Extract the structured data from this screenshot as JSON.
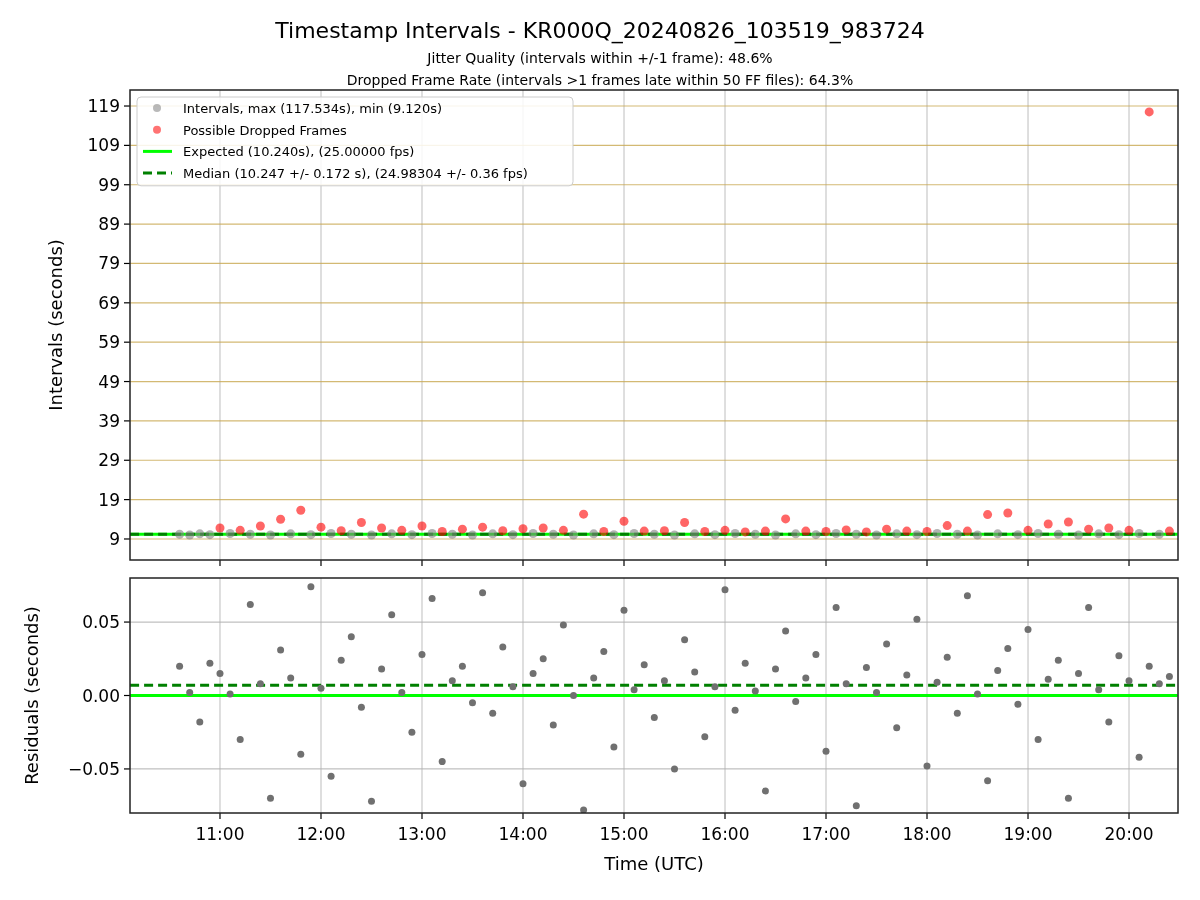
{
  "title": "Timestamp Intervals - KR000Q_20240826_103519_983724",
  "subtitles": [
    "Jitter Quality (intervals within +/-1 frame): 48.6%",
    "Dropped Frame Rate (intervals >1 frames late within 50 FF files): 64.3%"
  ],
  "intervals_panel": {
    "chart_data": {
      "type": "scatter",
      "ylabel": "Intervals (seconds)",
      "grid": true,
      "legend": "upper left",
      "x": [
        10.11,
        10.6,
        10.7,
        10.8,
        10.9,
        11.0,
        11.1,
        11.2,
        11.3,
        11.4,
        11.5,
        11.6,
        11.7,
        11.8,
        11.9,
        12.0,
        12.1,
        12.2,
        12.3,
        12.4,
        12.5,
        12.6,
        12.7,
        12.8,
        12.9,
        13.0,
        13.1,
        13.2,
        13.3,
        13.4,
        13.5,
        13.6,
        13.7,
        13.8,
        13.9,
        14.0,
        14.1,
        14.2,
        14.3,
        14.4,
        14.5,
        14.6,
        14.7,
        14.8,
        14.9,
        15.0,
        15.1,
        15.2,
        15.3,
        15.4,
        15.5,
        15.6,
        15.7,
        15.8,
        15.9,
        16.0,
        16.1,
        16.2,
        16.3,
        16.4,
        16.5,
        16.6,
        16.7,
        16.8,
        16.9,
        17.0,
        17.1,
        17.2,
        17.3,
        17.4,
        17.5,
        17.6,
        17.7,
        17.8,
        17.9,
        18.0,
        18.1,
        18.2,
        18.3,
        18.4,
        18.5,
        18.6,
        18.7,
        18.8,
        18.9,
        19.0,
        19.1,
        19.2,
        19.3,
        19.4,
        19.5,
        19.6,
        19.7,
        19.8,
        19.9,
        20.0,
        20.1,
        20.2,
        20.3,
        20.4,
        20.48
      ],
      "series": [
        {
          "name": "Intervals, max (117.534s), min (9.120s)",
          "color": "#808080",
          "values": [
            null,
            10.2,
            10.0,
            10.3,
            10.1,
            null,
            10.4,
            null,
            10.2,
            null,
            10.0,
            null,
            10.3,
            null,
            10.1,
            null,
            10.4,
            null,
            10.2,
            null,
            10.0,
            null,
            10.3,
            null,
            10.1,
            null,
            10.4,
            null,
            10.2,
            null,
            10.0,
            null,
            10.3,
            null,
            10.1,
            null,
            10.4,
            null,
            10.2,
            null,
            10.0,
            null,
            10.3,
            null,
            10.1,
            null,
            10.4,
            null,
            10.2,
            null,
            10.0,
            null,
            10.3,
            null,
            10.1,
            null,
            10.4,
            null,
            10.2,
            null,
            10.0,
            null,
            10.3,
            null,
            10.1,
            null,
            10.4,
            null,
            10.2,
            null,
            10.0,
            null,
            10.3,
            null,
            10.1,
            null,
            10.4,
            null,
            10.2,
            null,
            10.0,
            null,
            10.3,
            null,
            10.1,
            null,
            10.4,
            null,
            10.2,
            null,
            10.0,
            null,
            10.3,
            null,
            10.1,
            null,
            10.4,
            null,
            10.2,
            null,
            null
          ]
        },
        {
          "name": "Possible Dropped Frames",
          "color": "#ff0000",
          "values": [
            null,
            null,
            null,
            null,
            null,
            11.8,
            null,
            11.2,
            null,
            12.3,
            null,
            14.0,
            null,
            16.3,
            null,
            12.0,
            null,
            11.1,
            null,
            13.2,
            null,
            11.8,
            null,
            11.2,
            null,
            12.3,
            null,
            10.9,
            null,
            11.5,
            null,
            12.0,
            null,
            11.1,
            null,
            11.6,
            null,
            11.8,
            null,
            11.2,
            null,
            15.3,
            null,
            10.9,
            null,
            13.5,
            null,
            11.0,
            null,
            11.1,
            null,
            13.2,
            null,
            10.9,
            null,
            11.2,
            null,
            10.8,
            null,
            11.0,
            null,
            14.1,
            null,
            11.0,
            null,
            10.9,
            null,
            11.3,
            null,
            10.8,
            null,
            11.5,
            null,
            11.0,
            null,
            10.9,
            null,
            12.4,
            null,
            11.0,
            null,
            15.2,
            null,
            15.6,
            null,
            11.2,
            null,
            12.8,
            null,
            13.3,
            null,
            11.5,
            null,
            11.8,
            null,
            11.2,
            null,
            117.5,
            null,
            11.0,
            null
          ]
        },
        {
          "name": "Expected (10.240s), (25.00000 fps)",
          "color": "#00ff00",
          "type": "line",
          "line_style": "solid",
          "values": [
            10.2,
            10.2,
            10.2,
            10.2,
            10.2,
            10.2,
            10.2,
            10.2,
            10.2,
            10.2,
            10.2,
            10.2,
            10.2,
            10.2,
            10.2,
            10.2,
            10.2,
            10.2,
            10.2,
            10.2,
            10.2,
            10.2,
            10.2,
            10.2,
            10.2,
            10.2,
            10.2,
            10.2,
            10.2,
            10.2,
            10.2,
            10.2,
            10.2,
            10.2,
            10.2,
            10.2,
            10.2,
            10.2,
            10.2,
            10.2,
            10.2,
            10.2,
            10.2,
            10.2,
            10.2,
            10.2,
            10.2,
            10.2,
            10.2,
            10.2,
            10.2,
            10.2,
            10.2,
            10.2,
            10.2,
            10.2,
            10.2,
            10.2,
            10.2,
            10.2,
            10.2,
            10.2,
            10.2,
            10.2,
            10.2,
            10.2,
            10.2,
            10.2,
            10.2,
            10.2,
            10.2,
            10.2,
            10.2,
            10.2,
            10.2,
            10.2,
            10.2,
            10.2,
            10.2,
            10.2,
            10.2,
            10.2,
            10.2,
            10.2,
            10.2,
            10.2,
            10.2,
            10.2,
            10.2,
            10.2,
            10.2,
            10.2,
            10.2,
            10.2,
            10.2,
            10.2,
            10.2,
            10.2,
            10.2,
            10.2,
            10.2
          ]
        },
        {
          "name": "Median (10.247 +/- 0.172 s), (24.98304 +/- 0.36 fps)",
          "color": "#008000",
          "type": "line",
          "line_style": "dashed",
          "values": [
            10.2,
            10.2,
            10.2,
            10.2,
            10.2,
            10.2,
            10.2,
            10.2,
            10.2,
            10.2,
            10.2,
            10.2,
            10.2,
            10.2,
            10.2,
            10.2,
            10.2,
            10.2,
            10.2,
            10.2,
            10.2,
            10.2,
            10.2,
            10.2,
            10.2,
            10.2,
            10.2,
            10.2,
            10.2,
            10.2,
            10.2,
            10.2,
            10.2,
            10.2,
            10.2,
            10.2,
            10.2,
            10.2,
            10.2,
            10.2,
            10.2,
            10.2,
            10.2,
            10.2,
            10.2,
            10.2,
            10.2,
            10.2,
            10.2,
            10.2,
            10.2,
            10.2,
            10.2,
            10.2,
            10.2,
            10.2,
            10.2,
            10.2,
            10.2,
            10.2,
            10.2,
            10.2,
            10.2,
            10.2,
            10.2,
            10.2,
            10.2,
            10.2,
            10.2,
            10.2,
            10.2,
            10.2,
            10.2,
            10.2,
            10.2,
            10.2,
            10.2,
            10.2,
            10.2,
            10.2,
            10.2,
            10.2,
            10.2,
            10.2,
            10.2,
            10.2,
            10.2,
            10.2,
            10.2,
            10.2,
            10.2,
            10.2,
            10.2,
            10.2,
            10.2,
            10.2,
            10.2,
            10.2,
            10.2,
            10.2,
            10.2
          ]
        }
      ],
      "xlim": [
        10.109,
        20.485
      ],
      "ylim": [
        3.66,
        123.07
      ],
      "yticks": [
        9,
        19,
        29,
        39,
        49,
        59,
        69,
        79,
        89,
        99,
        109,
        119
      ]
    }
  },
  "residuals_panel": {
    "chart_data": {
      "type": "scatter",
      "xlabel": "Time (UTC)",
      "ylabel": "Residuals (seconds)",
      "grid": true,
      "x": [
        10.11,
        10.6,
        10.7,
        10.8,
        10.9,
        11.0,
        11.1,
        11.2,
        11.3,
        11.4,
        11.5,
        11.6,
        11.7,
        11.8,
        11.9,
        12.0,
        12.1,
        12.2,
        12.3,
        12.4,
        12.5,
        12.6,
        12.7,
        12.8,
        12.9,
        13.0,
        13.1,
        13.2,
        13.3,
        13.4,
        13.5,
        13.6,
        13.7,
        13.8,
        13.9,
        14.0,
        14.1,
        14.2,
        14.3,
        14.4,
        14.5,
        14.6,
        14.7,
        14.8,
        14.9,
        15.0,
        15.1,
        15.2,
        15.3,
        15.4,
        15.5,
        15.6,
        15.7,
        15.8,
        15.9,
        16.0,
        16.1,
        16.2,
        16.3,
        16.4,
        16.5,
        16.6,
        16.7,
        16.8,
        16.9,
        17.0,
        17.1,
        17.2,
        17.3,
        17.4,
        17.5,
        17.6,
        17.7,
        17.8,
        17.9,
        18.0,
        18.1,
        18.2,
        18.3,
        18.4,
        18.5,
        18.6,
        18.7,
        18.8,
        18.9,
        19.0,
        19.1,
        19.2,
        19.3,
        19.4,
        19.5,
        19.6,
        19.7,
        19.8,
        19.9,
        20.0,
        20.1,
        20.2,
        20.3,
        20.4,
        20.48
      ],
      "series": [
        {
          "color": "#707070",
          "values": [
            null,
            0.02,
            0.002,
            -0.018,
            0.022,
            0.015,
            0.001,
            -0.03,
            0.062,
            0.008,
            -0.07,
            0.031,
            0.012,
            -0.04,
            0.074,
            0.005,
            -0.055,
            0.024,
            0.04,
            -0.008,
            -0.072,
            0.018,
            0.055,
            0.002,
            -0.025,
            0.028,
            0.066,
            -0.045,
            0.01,
            0.02,
            -0.005,
            0.07,
            -0.012,
            0.033,
            0.006,
            -0.06,
            0.015,
            0.025,
            -0.02,
            0.048,
            0.0,
            -0.078,
            0.012,
            0.03,
            -0.035,
            0.058,
            0.004,
            0.021,
            -0.015,
            0.01,
            -0.05,
            0.038,
            0.016,
            -0.028,
            0.006,
            0.072,
            -0.01,
            0.022,
            0.003,
            -0.065,
            0.018,
            0.044,
            -0.004,
            0.012,
            0.028,
            -0.038,
            0.06,
            0.008,
            -0.075,
            0.019,
            0.002,
            0.035,
            -0.022,
            0.014,
            0.052,
            -0.048,
            0.009,
            0.026,
            -0.012,
            0.068,
            0.001,
            -0.058,
            0.017,
            0.032,
            -0.006,
            0.045,
            -0.03,
            0.011,
            0.024,
            -0.07,
            0.015,
            0.06,
            0.004,
            -0.018,
            0.027,
            0.01,
            -0.042,
            0.02,
            0.008,
            0.013,
            null
          ]
        },
        {
          "color": "#00ff00",
          "type": "line",
          "line_style": "solid",
          "values": [
            0,
            0,
            0,
            0,
            0,
            0,
            0,
            0,
            0,
            0,
            0,
            0,
            0,
            0,
            0,
            0,
            0,
            0,
            0,
            0,
            0,
            0,
            0,
            0,
            0,
            0,
            0,
            0,
            0,
            0,
            0,
            0,
            0,
            0,
            0,
            0,
            0,
            0,
            0,
            0,
            0,
            0,
            0,
            0,
            0,
            0,
            0,
            0,
            0,
            0,
            0,
            0,
            0,
            0,
            0,
            0,
            0,
            0,
            0,
            0,
            0,
            0,
            0,
            0,
            0,
            0,
            0,
            0,
            0,
            0,
            0,
            0,
            0,
            0,
            0,
            0,
            0,
            0,
            0,
            0,
            0,
            0,
            0,
            0,
            0,
            0,
            0,
            0,
            0,
            0,
            0,
            0,
            0,
            0,
            0,
            0,
            0,
            0,
            0,
            0,
            0
          ]
        },
        {
          "color": "#008000",
          "type": "line",
          "line_style": "dashed",
          "values": [
            0.007,
            0.007,
            0.007,
            0.007,
            0.007,
            0.007,
            0.007,
            0.007,
            0.007,
            0.007,
            0.007,
            0.007,
            0.007,
            0.007,
            0.007,
            0.007,
            0.007,
            0.007,
            0.007,
            0.007,
            0.007,
            0.007,
            0.007,
            0.007,
            0.007,
            0.007,
            0.007,
            0.007,
            0.007,
            0.007,
            0.007,
            0.007,
            0.007,
            0.007,
            0.007,
            0.007,
            0.007,
            0.007,
            0.007,
            0.007,
            0.007,
            0.007,
            0.007,
            0.007,
            0.007,
            0.007,
            0.007,
            0.007,
            0.007,
            0.007,
            0.007,
            0.007,
            0.007,
            0.007,
            0.007,
            0.007,
            0.007,
            0.007,
            0.007,
            0.007,
            0.007,
            0.007,
            0.007,
            0.007,
            0.007,
            0.007,
            0.007,
            0.007,
            0.007,
            0.007,
            0.007,
            0.007,
            0.007,
            0.007,
            0.007,
            0.007,
            0.007,
            0.007,
            0.007,
            0.007,
            0.007,
            0.007,
            0.007,
            0.007,
            0.007,
            0.007,
            0.007,
            0.007,
            0.007,
            0.007,
            0.007,
            0.007,
            0.007,
            0.007,
            0.007,
            0.007,
            0.007,
            0.007,
            0.007,
            0.007,
            0.007
          ]
        }
      ],
      "xlim": [
        10.109,
        20.485
      ],
      "ylim": [
        -0.08,
        0.08
      ],
      "xticks": [
        {
          "value": 11,
          "label": "11:00"
        },
        {
          "value": 12,
          "label": "12:00"
        },
        {
          "value": 13,
          "label": "13:00"
        },
        {
          "value": 14,
          "label": "14:00"
        },
        {
          "value": 15,
          "label": "15:00"
        },
        {
          "value": 16,
          "label": "16:00"
        },
        {
          "value": 17,
          "label": "17:00"
        },
        {
          "value": 18,
          "label": "18:00"
        },
        {
          "value": 19,
          "label": "19:00"
        },
        {
          "value": 20,
          "label": "20:00"
        }
      ],
      "yticks": [
        {
          "value": -0.05,
          "label": "−0.05"
        },
        {
          "value": 0,
          "label": "0.00"
        },
        {
          "value": 0.05,
          "label": "0.05"
        }
      ]
    }
  }
}
